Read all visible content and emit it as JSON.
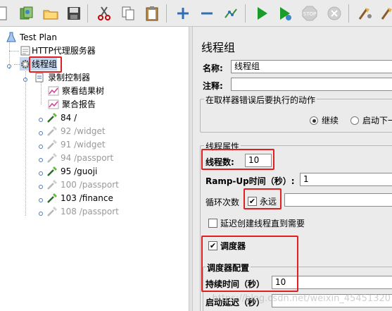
{
  "toolbar": {
    "buttons": [
      "new-icon",
      "templates-icon",
      "open-icon",
      "save-icon",
      "cut-icon",
      "copy-icon",
      "paste-icon",
      "expand-icon",
      "collapse-icon",
      "toggle-icon",
      "start-icon",
      "start-no-pause-icon",
      "stop-icon",
      "shutdown-icon",
      "clear-icon",
      "clear-all-icon"
    ]
  },
  "tree": {
    "test_plan": "Test Plan",
    "proxy": "HTTP代理服务器",
    "thread_group": "线程组",
    "recorder": "录制控制器",
    "results_tree": "察看结果树",
    "aggregate": "聚合报告",
    "samplers": [
      {
        "label": "84 /",
        "enabled": true
      },
      {
        "label": "92 /widget",
        "enabled": false
      },
      {
        "label": "91 /widget",
        "enabled": false
      },
      {
        "label": "94 /passport",
        "enabled": false
      },
      {
        "label": "95 /guoji",
        "enabled": true
      },
      {
        "label": "100 /passport",
        "enabled": false
      },
      {
        "label": "103 /finance",
        "enabled": true
      },
      {
        "label": "108 /passport",
        "enabled": false
      }
    ]
  },
  "panel": {
    "title": "线程组",
    "name_label": "名称:",
    "name_value": "线程组",
    "comment_label": "注释:",
    "comment_value": "",
    "error_action_legend": "在取样器错误后要执行的动作",
    "radio_continue": "继续",
    "radio_start_next": "启动下一",
    "thread_props_legend": "线程属性",
    "threads_label": "线程数:",
    "threads_value": "10",
    "rampup_label": "Ramp-Up时间（秒）:",
    "rampup_value": "1",
    "loop_label": "循环次数",
    "forever_label": "永远",
    "delay_create_label": "延迟创建线程直到需要",
    "scheduler_label": "调度器",
    "scheduler_config_legend": "调度器配置",
    "duration_label": "持续时间（秒）",
    "duration_value": "10",
    "startup_delay_label": "启动延迟（秒）"
  },
  "watermark": "https://blog.csdn.net/weixin_45451320",
  "colors": {
    "highlight": "#e02020",
    "selection": "#c5d7ee"
  }
}
